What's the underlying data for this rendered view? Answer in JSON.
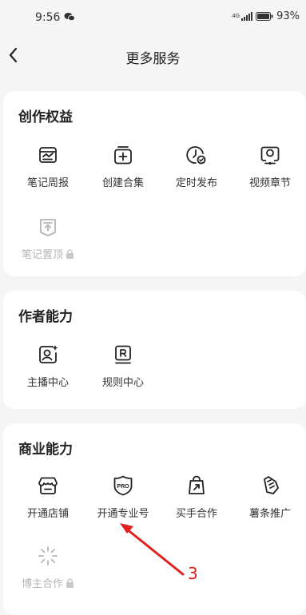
{
  "status": {
    "time": "9:56",
    "signal": "4G",
    "battery": "93%"
  },
  "nav": {
    "title": "更多服务"
  },
  "sections": [
    {
      "title": "创作权益",
      "items": [
        {
          "label": "笔记周报",
          "icon": "note-report-icon",
          "locked": false
        },
        {
          "label": "创建合集",
          "icon": "create-collection-icon",
          "locked": false
        },
        {
          "label": "定时发布",
          "icon": "scheduled-post-icon",
          "locked": false
        },
        {
          "label": "视频章节",
          "icon": "video-chapter-icon",
          "locked": false
        },
        {
          "label": "笔记置顶",
          "icon": "pin-note-icon",
          "locked": true
        }
      ]
    },
    {
      "title": "作者能力",
      "items": [
        {
          "label": "主播中心",
          "icon": "streamer-center-icon",
          "locked": false
        },
        {
          "label": "规则中心",
          "icon": "rules-center-icon",
          "locked": false
        }
      ]
    },
    {
      "title": "商业能力",
      "items": [
        {
          "label": "开通店铺",
          "icon": "store-icon",
          "locked": false
        },
        {
          "label": "开通专业号",
          "icon": "pro-account-icon",
          "locked": false
        },
        {
          "label": "买手合作",
          "icon": "buyer-cooperation-icon",
          "locked": false
        },
        {
          "label": "薯条推广",
          "icon": "promotion-icon",
          "locked": false
        },
        {
          "label": "博主合作",
          "icon": "blogger-cooperation-icon",
          "locked": true
        }
      ]
    }
  ],
  "annotation": {
    "label": "3",
    "color": "#e0201f"
  }
}
